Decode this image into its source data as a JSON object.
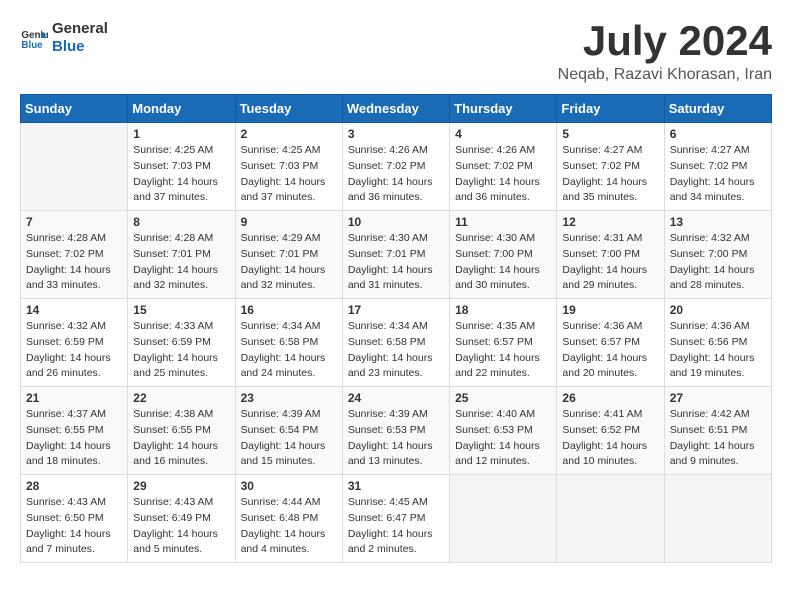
{
  "logo": {
    "text_general": "General",
    "text_blue": "Blue"
  },
  "title": "July 2024",
  "location": "Neqab, Razavi Khorasan, Iran",
  "headers": [
    "Sunday",
    "Monday",
    "Tuesday",
    "Wednesday",
    "Thursday",
    "Friday",
    "Saturday"
  ],
  "weeks": [
    [
      {
        "day": "",
        "sunrise": "",
        "sunset": "",
        "daylight": ""
      },
      {
        "day": "1",
        "sunrise": "Sunrise: 4:25 AM",
        "sunset": "Sunset: 7:03 PM",
        "daylight": "Daylight: 14 hours and 37 minutes."
      },
      {
        "day": "2",
        "sunrise": "Sunrise: 4:25 AM",
        "sunset": "Sunset: 7:03 PM",
        "daylight": "Daylight: 14 hours and 37 minutes."
      },
      {
        "day": "3",
        "sunrise": "Sunrise: 4:26 AM",
        "sunset": "Sunset: 7:02 PM",
        "daylight": "Daylight: 14 hours and 36 minutes."
      },
      {
        "day": "4",
        "sunrise": "Sunrise: 4:26 AM",
        "sunset": "Sunset: 7:02 PM",
        "daylight": "Daylight: 14 hours and 36 minutes."
      },
      {
        "day": "5",
        "sunrise": "Sunrise: 4:27 AM",
        "sunset": "Sunset: 7:02 PM",
        "daylight": "Daylight: 14 hours and 35 minutes."
      },
      {
        "day": "6",
        "sunrise": "Sunrise: 4:27 AM",
        "sunset": "Sunset: 7:02 PM",
        "daylight": "Daylight: 14 hours and 34 minutes."
      }
    ],
    [
      {
        "day": "7",
        "sunrise": "Sunrise: 4:28 AM",
        "sunset": "Sunset: 7:02 PM",
        "daylight": "Daylight: 14 hours and 33 minutes."
      },
      {
        "day": "8",
        "sunrise": "Sunrise: 4:28 AM",
        "sunset": "Sunset: 7:01 PM",
        "daylight": "Daylight: 14 hours and 32 minutes."
      },
      {
        "day": "9",
        "sunrise": "Sunrise: 4:29 AM",
        "sunset": "Sunset: 7:01 PM",
        "daylight": "Daylight: 14 hours and 32 minutes."
      },
      {
        "day": "10",
        "sunrise": "Sunrise: 4:30 AM",
        "sunset": "Sunset: 7:01 PM",
        "daylight": "Daylight: 14 hours and 31 minutes."
      },
      {
        "day": "11",
        "sunrise": "Sunrise: 4:30 AM",
        "sunset": "Sunset: 7:00 PM",
        "daylight": "Daylight: 14 hours and 30 minutes."
      },
      {
        "day": "12",
        "sunrise": "Sunrise: 4:31 AM",
        "sunset": "Sunset: 7:00 PM",
        "daylight": "Daylight: 14 hours and 29 minutes."
      },
      {
        "day": "13",
        "sunrise": "Sunrise: 4:32 AM",
        "sunset": "Sunset: 7:00 PM",
        "daylight": "Daylight: 14 hours and 28 minutes."
      }
    ],
    [
      {
        "day": "14",
        "sunrise": "Sunrise: 4:32 AM",
        "sunset": "Sunset: 6:59 PM",
        "daylight": "Daylight: 14 hours and 26 minutes."
      },
      {
        "day": "15",
        "sunrise": "Sunrise: 4:33 AM",
        "sunset": "Sunset: 6:59 PM",
        "daylight": "Daylight: 14 hours and 25 minutes."
      },
      {
        "day": "16",
        "sunrise": "Sunrise: 4:34 AM",
        "sunset": "Sunset: 6:58 PM",
        "daylight": "Daylight: 14 hours and 24 minutes."
      },
      {
        "day": "17",
        "sunrise": "Sunrise: 4:34 AM",
        "sunset": "Sunset: 6:58 PM",
        "daylight": "Daylight: 14 hours and 23 minutes."
      },
      {
        "day": "18",
        "sunrise": "Sunrise: 4:35 AM",
        "sunset": "Sunset: 6:57 PM",
        "daylight": "Daylight: 14 hours and 22 minutes."
      },
      {
        "day": "19",
        "sunrise": "Sunrise: 4:36 AM",
        "sunset": "Sunset: 6:57 PM",
        "daylight": "Daylight: 14 hours and 20 minutes."
      },
      {
        "day": "20",
        "sunrise": "Sunrise: 4:36 AM",
        "sunset": "Sunset: 6:56 PM",
        "daylight": "Daylight: 14 hours and 19 minutes."
      }
    ],
    [
      {
        "day": "21",
        "sunrise": "Sunrise: 4:37 AM",
        "sunset": "Sunset: 6:55 PM",
        "daylight": "Daylight: 14 hours and 18 minutes."
      },
      {
        "day": "22",
        "sunrise": "Sunrise: 4:38 AM",
        "sunset": "Sunset: 6:55 PM",
        "daylight": "Daylight: 14 hours and 16 minutes."
      },
      {
        "day": "23",
        "sunrise": "Sunrise: 4:39 AM",
        "sunset": "Sunset: 6:54 PM",
        "daylight": "Daylight: 14 hours and 15 minutes."
      },
      {
        "day": "24",
        "sunrise": "Sunrise: 4:39 AM",
        "sunset": "Sunset: 6:53 PM",
        "daylight": "Daylight: 14 hours and 13 minutes."
      },
      {
        "day": "25",
        "sunrise": "Sunrise: 4:40 AM",
        "sunset": "Sunset: 6:53 PM",
        "daylight": "Daylight: 14 hours and 12 minutes."
      },
      {
        "day": "26",
        "sunrise": "Sunrise: 4:41 AM",
        "sunset": "Sunset: 6:52 PM",
        "daylight": "Daylight: 14 hours and 10 minutes."
      },
      {
        "day": "27",
        "sunrise": "Sunrise: 4:42 AM",
        "sunset": "Sunset: 6:51 PM",
        "daylight": "Daylight: 14 hours and 9 minutes."
      }
    ],
    [
      {
        "day": "28",
        "sunrise": "Sunrise: 4:43 AM",
        "sunset": "Sunset: 6:50 PM",
        "daylight": "Daylight: 14 hours and 7 minutes."
      },
      {
        "day": "29",
        "sunrise": "Sunrise: 4:43 AM",
        "sunset": "Sunset: 6:49 PM",
        "daylight": "Daylight: 14 hours and 5 minutes."
      },
      {
        "day": "30",
        "sunrise": "Sunrise: 4:44 AM",
        "sunset": "Sunset: 6:48 PM",
        "daylight": "Daylight: 14 hours and 4 minutes."
      },
      {
        "day": "31",
        "sunrise": "Sunrise: 4:45 AM",
        "sunset": "Sunset: 6:47 PM",
        "daylight": "Daylight: 14 hours and 2 minutes."
      },
      {
        "day": "",
        "sunrise": "",
        "sunset": "",
        "daylight": ""
      },
      {
        "day": "",
        "sunrise": "",
        "sunset": "",
        "daylight": ""
      },
      {
        "day": "",
        "sunrise": "",
        "sunset": "",
        "daylight": ""
      }
    ]
  ]
}
